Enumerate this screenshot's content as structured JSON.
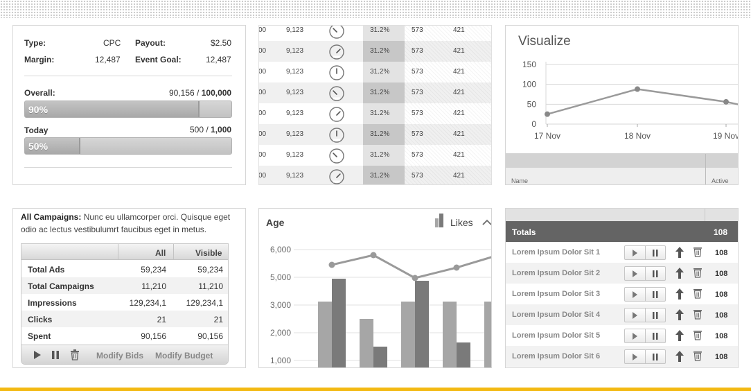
{
  "campaign": {
    "type_label": "Type:",
    "type_value": "CPC",
    "payout_label": "Payout:",
    "payout_value": "$2.50",
    "margin_label": "Margin:",
    "margin_value": "12,487",
    "goal_label": "Event Goal:",
    "goal_value": "12,487",
    "overall": {
      "label": "Overall:",
      "current": "90,156",
      "sep": " / ",
      "total": "100,000",
      "percent_text": "90%",
      "fraction": 0.9
    },
    "today": {
      "label": "Today",
      "current": "500",
      "sep": " / ",
      "total": "1,000",
      "percent_text": "50%",
      "fraction": 0.5
    }
  },
  "stats_table": {
    "rows": [
      {
        "c1": "00",
        "c2": "9,123",
        "pct": "31.2%",
        "c4": "573",
        "c5": "421",
        "gauge": "gauge-left-icon"
      },
      {
        "c1": "00",
        "c2": "9,123",
        "pct": "31.2%",
        "c4": "573",
        "c5": "421",
        "gauge": "gauge-right-icon"
      },
      {
        "c1": "00",
        "c2": "9,123",
        "pct": "31.2%",
        "c4": "573",
        "c5": "421",
        "gauge": "gauge-center-icon"
      },
      {
        "c1": "00",
        "c2": "9,123",
        "pct": "31.2%",
        "c4": "573",
        "c5": "421",
        "gauge": "gauge-left-icon"
      },
      {
        "c1": "00",
        "c2": "9,123",
        "pct": "31.2%",
        "c4": "573",
        "c5": "421",
        "gauge": "gauge-right-icon"
      },
      {
        "c1": "00",
        "c2": "9,123",
        "pct": "31.2%",
        "c4": "573",
        "c5": "421",
        "gauge": "gauge-center-icon"
      },
      {
        "c1": "00",
        "c2": "9,123",
        "pct": "31.2%",
        "c4": "573",
        "c5": "421",
        "gauge": "gauge-left-icon"
      },
      {
        "c1": "00",
        "c2": "9,123",
        "pct": "31.2%",
        "c4": "573",
        "c5": "421",
        "gauge": "gauge-right-icon"
      }
    ]
  },
  "visualize": {
    "title": "Visualize",
    "grid_head": {
      "col1": "Name",
      "col2": "Active"
    }
  },
  "campaigns": {
    "intro_bold": "All Campaigns:",
    "intro_text": " Nunc eu ullamcorper orci. Quisque eget odio ac lectus vestibulumrt faucibus eget in metus.",
    "headers": [
      "All",
      "Visible"
    ],
    "rows": [
      {
        "label": "Total Ads",
        "all": "59,234",
        "visible": "59,234"
      },
      {
        "label": "Total Campaigns",
        "all": "11,210",
        "visible": "11,210"
      },
      {
        "label": "Impressions",
        "all": "129,234,1",
        "visible": "129,234,1"
      },
      {
        "label": "Clicks",
        "all": "21",
        "visible": "21"
      },
      {
        "label": "Spent",
        "all": "90,156",
        "visible": "90,156"
      }
    ],
    "modify_bids": "Modify Bids",
    "modify_budget": "Modify Budget"
  },
  "age_panel": {
    "title": "Age",
    "legend_label": "Likes"
  },
  "totals": {
    "label": "Totals",
    "value": "108",
    "items": [
      {
        "name": "Lorem Ipsum Dolor Sit 1",
        "value": "108"
      },
      {
        "name": "Lorem Ipsum Dolor Sit 2",
        "value": "108"
      },
      {
        "name": "Lorem Ipsum Dolor Sit 3",
        "value": "108"
      },
      {
        "name": "Lorem Ipsum Dolor Sit 4",
        "value": "108"
      },
      {
        "name": "Lorem Ipsum Dolor Sit 5",
        "value": "108"
      },
      {
        "name": "Lorem Ipsum Dolor Sit 6",
        "value": "108"
      }
    ]
  },
  "colors": {
    "accent_bar": "#f3b912",
    "totals_bg": "#646464",
    "bar_light": "#a6a6a6",
    "bar_dark": "#7a7a7a",
    "line": "#9a9a9a"
  },
  "chart_data": [
    {
      "type": "line",
      "title": "Visualize",
      "x": [
        "17 Nov",
        "18 Nov",
        "19 Nov"
      ],
      "series": [
        {
          "values": [
            25,
            88,
            56
          ]
        }
      ],
      "ylim": [
        0,
        150
      ],
      "yticks": [
        "0",
        "50",
        "100",
        "150"
      ],
      "grid": true
    },
    {
      "type": "bar",
      "title": "Age",
      "categories": [
        "",
        "",
        "",
        "",
        ""
      ],
      "series": [
        {
          "values": [
            3250,
            2500,
            3250,
            3250,
            3250
          ]
        },
        {
          "name": "Likes",
          "values": [
            4900,
            1500,
            4750,
            1650,
            null
          ]
        }
      ],
      "line": {
        "values": [
          5450,
          5800,
          4950,
          5350,
          5800
        ]
      },
      "yticks": [
        "1,000",
        "2,000",
        "3,000",
        "5,000",
        "6,000"
      ],
      "grid": true
    }
  ]
}
